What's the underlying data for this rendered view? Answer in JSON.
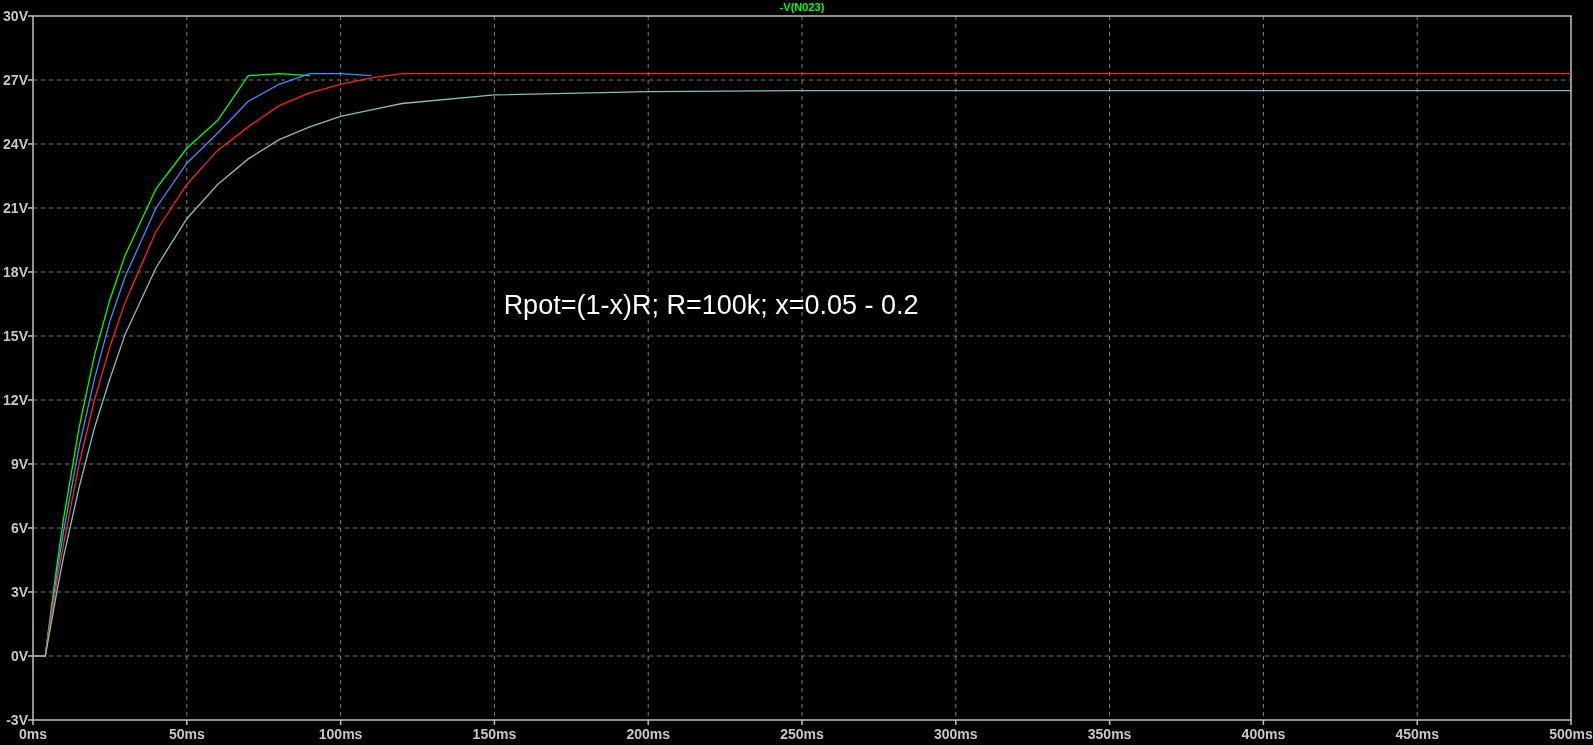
{
  "plot": {
    "chart_data": {
      "type": "line",
      "title": "-V(N023)",
      "x": [
        0,
        4,
        5,
        8,
        10,
        15,
        20,
        25,
        30,
        40,
        50,
        60,
        70,
        80,
        90,
        100,
        110,
        120,
        150,
        200,
        250,
        300,
        350,
        400,
        450,
        500
      ],
      "series": [
        {
          "color": "#00ff00",
          "values": [
            0,
            0,
            1.2,
            4.5,
            6.5,
            10.7,
            14.1,
            16.7,
            18.8,
            21.9,
            23.8,
            25.1,
            27.2,
            27.3,
            27.2,
            null,
            null,
            null,
            null,
            null,
            null,
            null,
            null,
            null,
            null,
            null
          ]
        },
        {
          "color": "#3f8fff",
          "values": [
            0,
            0,
            1.1,
            4.1,
            5.9,
            9.8,
            13.0,
            15.7,
            17.8,
            21.0,
            23.1,
            24.5,
            26.0,
            26.8,
            27.3,
            27.3,
            27.2,
            null,
            null,
            null,
            null,
            null,
            null,
            null,
            null,
            null
          ]
        },
        {
          "color": "#ff2020",
          "values": [
            0,
            0,
            1.0,
            3.7,
            5.3,
            9.0,
            12.0,
            14.5,
            16.6,
            19.9,
            22.1,
            23.7,
            24.8,
            25.8,
            26.4,
            26.8,
            27.1,
            27.3,
            27.3,
            27.3,
            27.3,
            27.3,
            27.3,
            27.3,
            27.3,
            27.3
          ]
        },
        {
          "color": "#80c0c0",
          "values": [
            0,
            0,
            0.8,
            3.2,
            4.7,
            7.9,
            10.7,
            13.0,
            15.1,
            18.2,
            20.5,
            22.1,
            23.3,
            24.2,
            24.8,
            25.3,
            25.6,
            25.9,
            26.3,
            26.45,
            26.5,
            26.5,
            26.5,
            26.5,
            26.5,
            26.5
          ]
        }
      ],
      "grid": true,
      "xlim": [
        0,
        500
      ],
      "ylim": [
        -3,
        30
      ],
      "xticks": [
        {
          "value": 0,
          "label": "0ms"
        },
        {
          "value": 50,
          "label": "50ms"
        },
        {
          "value": 100,
          "label": "100ms"
        },
        {
          "value": 150,
          "label": "150ms"
        },
        {
          "value": 200,
          "label": "200ms"
        },
        {
          "value": 250,
          "label": "250ms"
        },
        {
          "value": 300,
          "label": "300ms"
        },
        {
          "value": 350,
          "label": "350ms"
        },
        {
          "value": 400,
          "label": "400ms"
        },
        {
          "value": 450,
          "label": "450ms"
        },
        {
          "value": 500,
          "label": "500ms"
        }
      ],
      "yticks": [
        {
          "value": 30,
          "label": "30V"
        },
        {
          "value": 27,
          "label": "27V"
        },
        {
          "value": 24,
          "label": "24V"
        },
        {
          "value": 21,
          "label": "21V"
        },
        {
          "value": 18,
          "label": "18V"
        },
        {
          "value": 15,
          "label": "15V"
        },
        {
          "value": 12,
          "label": "12V"
        },
        {
          "value": 9,
          "label": "9V"
        },
        {
          "value": 6,
          "label": "6V"
        },
        {
          "value": 3,
          "label": "3V"
        },
        {
          "value": 0,
          "label": "0V"
        },
        {
          "value": -3,
          "label": "-3V"
        }
      ],
      "annotations": [
        "Rpot=(1-x)R; R=100k; x=0.05 - 0.2"
      ]
    }
  }
}
